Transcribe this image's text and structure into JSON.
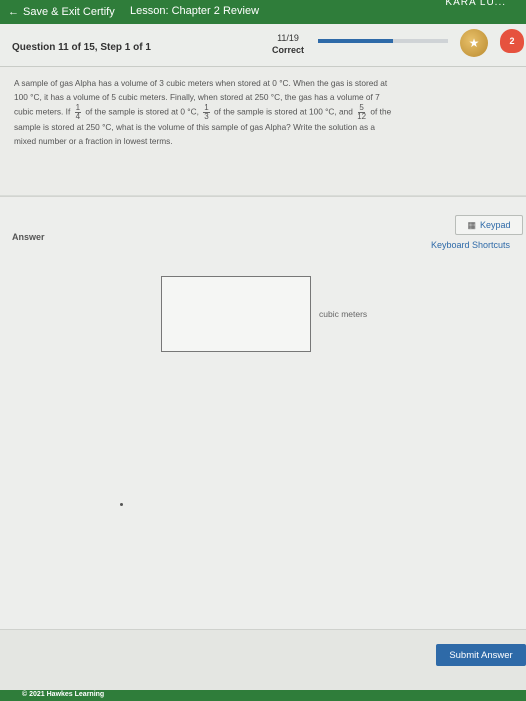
{
  "topbar": {
    "back_label": "Save & Exit Certify",
    "lesson": "Lesson: Chapter 2 Review",
    "user": "KARA LU..."
  },
  "header": {
    "question_label": "Question 11 of 15, Step 1 of 1",
    "score": "11/19",
    "score_status": "Correct",
    "progress_fraction": 0.58,
    "hearts": "2"
  },
  "question": {
    "line1_a": "A sample of gas Alpha has a volume of 3 cubic meters when stored at 0 °C. When the gas is stored at",
    "line2_a": "100 °C, it has a volume of 5 cubic meters. Finally, when stored at 250 °C, the gas has a volume of 7",
    "line3_a": "cubic meters. If",
    "frac1_n": "1",
    "frac1_d": "4",
    "line3_b": "of the sample is stored at 0 °C,",
    "frac2_n": "1",
    "frac2_d": "3",
    "line3_c": "of the sample is stored at 100 °C, and",
    "frac3_n": "5",
    "frac3_d": "12",
    "line3_d": "of the",
    "line4": "sample is stored at 250 °C, what is the volume of this sample of gas Alpha? Write the solution as a",
    "line5": "mixed number or a fraction in lowest terms."
  },
  "answer": {
    "label": "Answer",
    "keypad": "Keypad",
    "shortcuts": "Keyboard Shortcuts",
    "unit": "cubic meters"
  },
  "footer": {
    "submit": "Submit Answer",
    "copyright": "© 2021 Hawkes Learning"
  }
}
